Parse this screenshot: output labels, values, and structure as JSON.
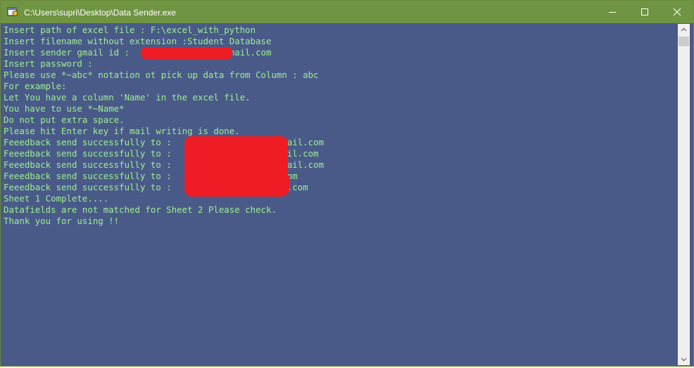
{
  "window": {
    "title": "C:\\Users\\supri\\Desktop\\Data Sender.exe",
    "controls": {
      "minimize": "minimize-icon",
      "maximize": "maximize-icon",
      "close": "close-icon"
    }
  },
  "console": {
    "lines": [
      "Insert path of excel file : F:\\excel_with_python",
      "Insert filename without extension :Student Database",
      "Insert sender gmail id :               18@gmail.com",
      "Insert password :",
      "Please use *~abc* notation ot pick up data from Column : abc",
      "For example:",
      "Let You have a column 'Name' in the excel file.",
      "You have to use *~Name*",
      "Do not put extra space.",
      "Please hit Enter key if mail writing is done.",
      "Feeedback send successfully to :                 99@gmail.com",
      "Feeedback send successfully to :                 3@gmail.com",
      "Feeedback send successfully to :                 52@gmail.com",
      "Feeedback send successfully to :               gmail.com",
      "Feeedback send successfully to :                @yahoo.com",
      "Sheet 1 Complete....",
      "Datafields are not matched for Sheet 2 Please check.",
      "Thank you for using !!"
    ]
  },
  "colors": {
    "console_bg": "#4a5a88",
    "console_text": "#9bf091",
    "titlebar": "#6f9442",
    "redaction": "#ee1c24"
  }
}
